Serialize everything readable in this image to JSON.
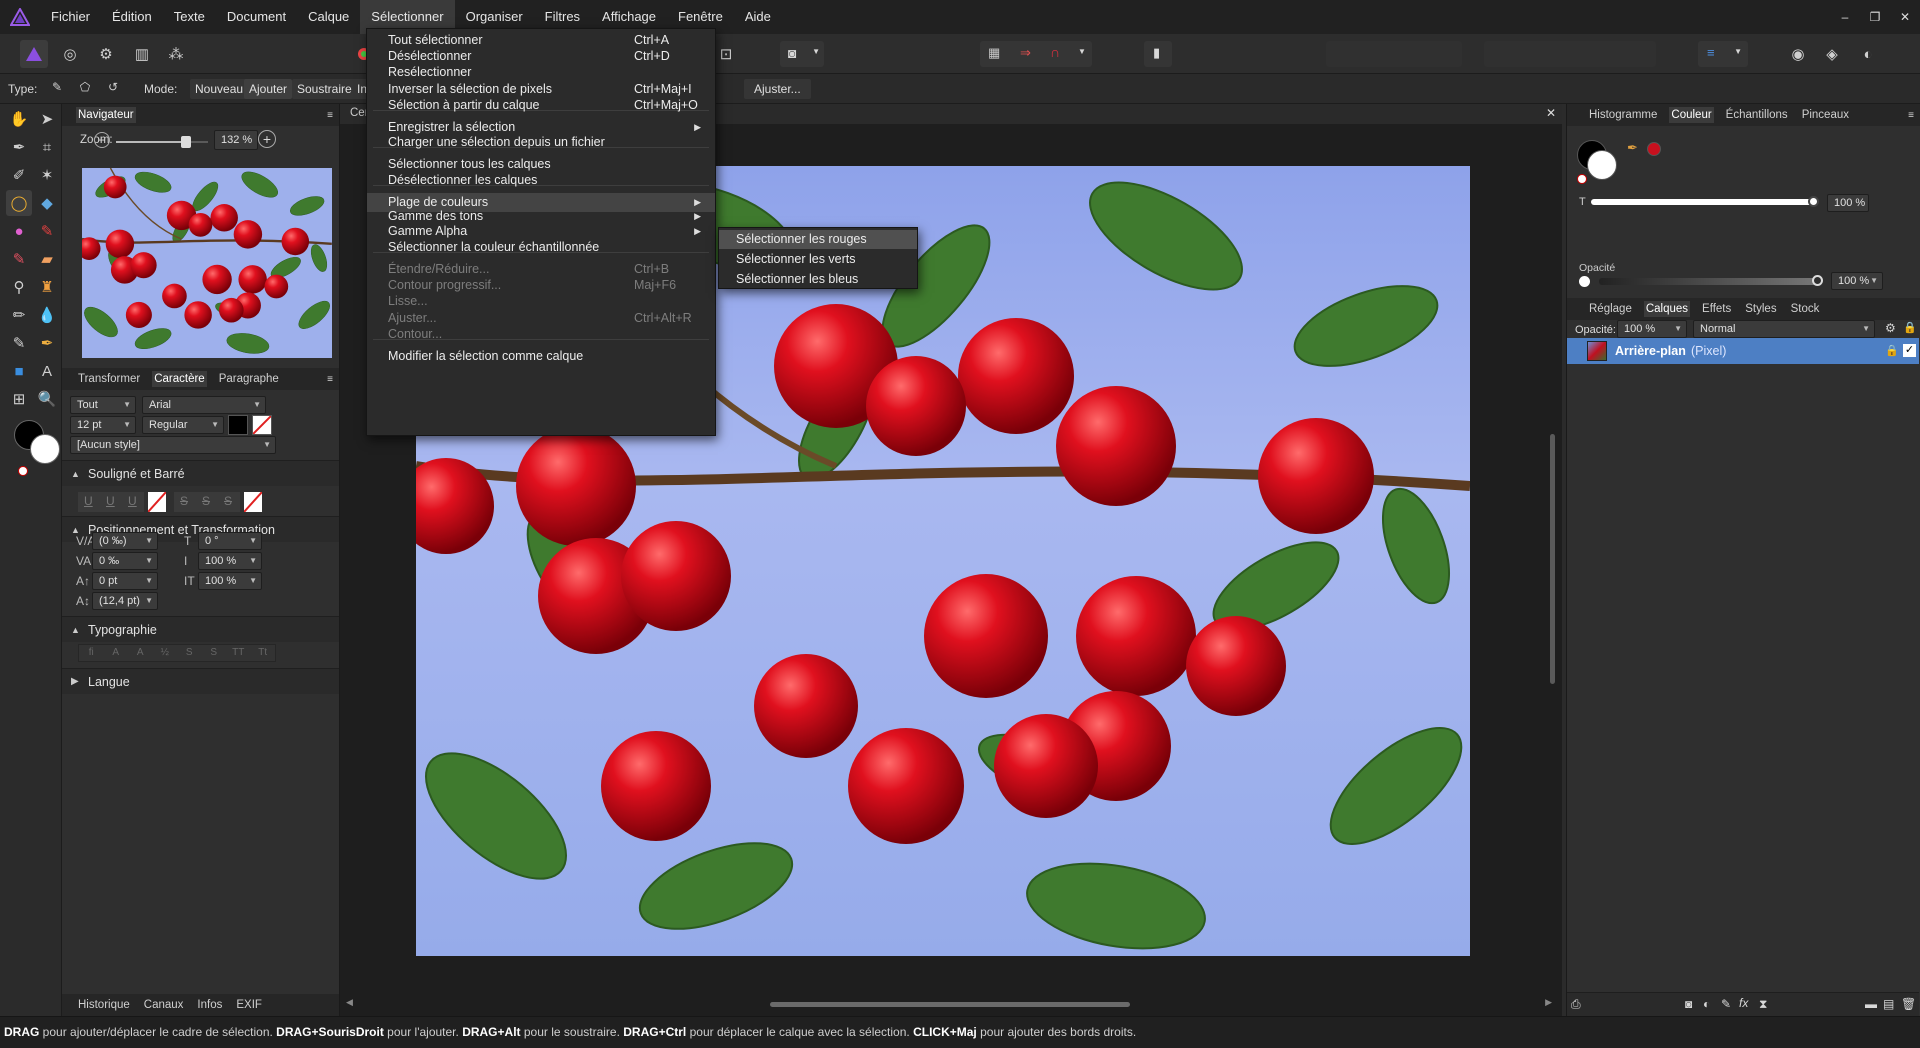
{
  "menubar": {
    "logo_icon": "affinity-photo-logo-icon",
    "items": [
      "Fichier",
      "Édition",
      "Texte",
      "Document",
      "Calque",
      "Sélectionner",
      "Organiser",
      "Filtres",
      "Affichage",
      "Fenêtre",
      "Aide"
    ],
    "active_index": 5,
    "window_controls": [
      "–",
      "❐",
      "✕"
    ]
  },
  "context_bar": {
    "type_label": "Type:",
    "mode_label": "Mode:",
    "modes": [
      "Nouveau",
      "Ajouter",
      "Soustraire",
      "In"
    ],
    "adjust_button": "Ajuster..."
  },
  "navigator": {
    "tab": "Navigateur",
    "zoom_label": "Zoom:",
    "zoom_value": "132 %",
    "zoom_fraction": 0.76
  },
  "character_panel": {
    "tabs": [
      "Transformer",
      "Caractère",
      "Paragraphe"
    ],
    "active_tab": 1,
    "scope": "Tout",
    "font": "Arial",
    "size": "12 pt",
    "weight": "Regular",
    "style": "[Aucun style]",
    "sections": {
      "underline": "Souligné et Barré",
      "positioning": "Positionnement et Transformation",
      "typography": "Typographie",
      "language": "Langue"
    },
    "underline_buttons": [
      "U",
      "U",
      "U",
      "S",
      "S",
      "S"
    ],
    "pos_fields": {
      "kerning": "(0 ‰)",
      "tracking": "0 ‰",
      "baseline": "0 pt",
      "leading": "(12,4 pt)",
      "shear": "0 °",
      "vscale": "100 %",
      "hscale": "100 %"
    },
    "typo_buttons": [
      "fi",
      "A",
      "A",
      "½",
      "S",
      "S",
      "TT",
      "Tt"
    ]
  },
  "left_bottom_tabs": [
    "Historique",
    "Canaux",
    "Infos",
    "EXIF"
  ],
  "doc_tab_label": "Cer",
  "select_menu": {
    "items": [
      {
        "label": "Tout sélectionner",
        "shortcut": "Ctrl+A"
      },
      {
        "label": "Désélectionner",
        "shortcut": "Ctrl+D"
      },
      {
        "label": "Resélectionner",
        "shortcut": ""
      },
      {
        "label": "Inverser la sélection de pixels",
        "shortcut": "Ctrl+Maj+I"
      },
      {
        "label": "Sélection à partir du calque",
        "shortcut": "Ctrl+Maj+O"
      },
      {
        "label": "Enregistrer la sélection",
        "submenu": true
      },
      {
        "label": "Charger une sélection depuis un fichier"
      },
      {
        "label": "Sélectionner tous les calques"
      },
      {
        "label": "Désélectionner les calques"
      },
      {
        "label": "Plage de couleurs",
        "submenu": true
      },
      {
        "label": "Gamme des tons",
        "submenu": true
      },
      {
        "label": "Gamme Alpha",
        "submenu": true
      },
      {
        "label": "Sélectionner la couleur échantillonnée"
      },
      {
        "label": "Étendre/Réduire...",
        "shortcut": "Ctrl+B",
        "disabled": true
      },
      {
        "label": "Contour progressif...",
        "shortcut": "Maj+F6",
        "disabled": true
      },
      {
        "label": "Lisse...",
        "disabled": true
      },
      {
        "label": "Ajuster...",
        "shortcut": "Ctrl+Alt+R",
        "disabled": true
      },
      {
        "label": "Contour...",
        "disabled": true
      },
      {
        "label": "Modifier la sélection comme calque"
      }
    ],
    "color_range_submenu": [
      "Sélectionner les rouges",
      "Sélectionner les verts",
      "Sélectionner les bleus"
    ]
  },
  "right_top": {
    "tabs": [
      "Histogramme",
      "Couleur",
      "Échantillons",
      "Pinceaux"
    ],
    "active_tab": 1,
    "tint_label": "T",
    "tint_value": "100 %",
    "opacity_label": "Opacité",
    "opacity_value": "100 %",
    "swatch_red": "#c8101e"
  },
  "layers": {
    "tabs": [
      "Réglage",
      "Calques",
      "Effets",
      "Styles",
      "Stock"
    ],
    "active_tab": 1,
    "opacity_label": "Opacité:",
    "opacity_value": "100 %",
    "blend_mode": "Normal",
    "layer_name": "Arrière-plan",
    "layer_type": "(Pixel)"
  },
  "status": {
    "parts": [
      {
        "b": "DRAG",
        "t": " pour ajouter/déplacer le cadre de sélection. "
      },
      {
        "b": "DRAG+SourisDroit",
        "t": " pour l'ajouter. "
      },
      {
        "b": "DRAG+Alt",
        "t": " pour le soustraire. "
      },
      {
        "b": "DRAG+Ctrl",
        "t": " pour déplacer le calque avec la sélection. "
      },
      {
        "b": "CLICK+Maj",
        "t": " pour ajouter des bords droits."
      }
    ]
  },
  "colors": {
    "accent": "#4d7fc4",
    "menu_bg": "#2b2b2b",
    "cherry_red": "#d20a1e"
  }
}
